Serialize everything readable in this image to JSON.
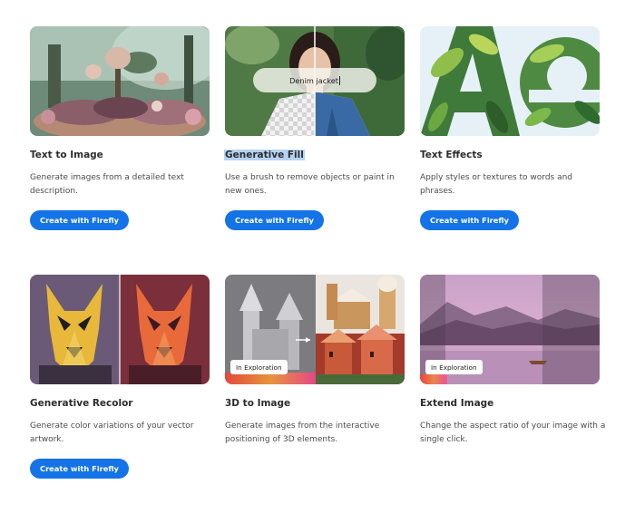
{
  "cards": [
    {
      "title": "Text to Image",
      "description": "Generate images from a detailed text description.",
      "button": "Create with Firefly",
      "thumbnail": "fantasy-garden-illustration"
    },
    {
      "title": "Generative Fill",
      "description": "Use a brush to remove objects or paint in new ones.",
      "button": "Create with Firefly",
      "thumbnail": "woman-portrait-fill",
      "prompt_text": "Denim jacket"
    },
    {
      "title": "Text Effects",
      "description": "Apply styles or textures to words and phrases.",
      "button": "Create with Firefly",
      "thumbnail": "leafy-letters-ae"
    },
    {
      "title": "Generative Recolor",
      "description": "Generate color variations of your vector artwork.",
      "button": "Create with Firefly",
      "thumbnail": "dog-vector-recolor"
    },
    {
      "title": "3D to Image",
      "description": "Generate images from the interactive positioning of 3D elements.",
      "thumbnail": "3d-castle-to-image",
      "badge": "In Exploration"
    },
    {
      "title": "Extend Image",
      "description": "Change the aspect ratio of your image with a single click.",
      "thumbnail": "lake-mountain-extend",
      "badge": "In Exploration"
    }
  ],
  "colors": {
    "button": "#1473e6",
    "title_selection": "#b6d3f4"
  }
}
